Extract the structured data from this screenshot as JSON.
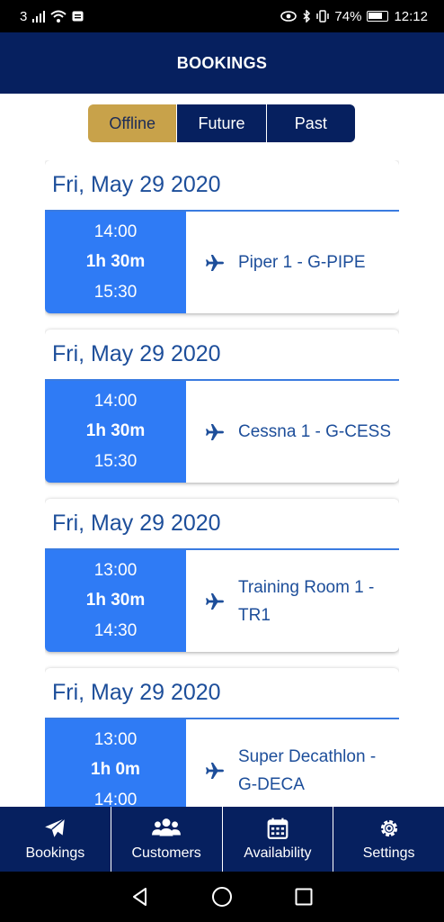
{
  "status_bar": {
    "carrier": "3",
    "battery": "74%",
    "time": "12:12"
  },
  "header": {
    "title": "BOOKINGS"
  },
  "tabs": [
    {
      "label": "Offline",
      "active": true
    },
    {
      "label": "Future",
      "active": false
    },
    {
      "label": "Past",
      "active": false
    }
  ],
  "bookings": [
    {
      "date": "Fri, May 29 2020",
      "start": "14:00",
      "duration": "1h 30m",
      "end": "15:30",
      "resource": "Piper 1 - G-PIPE"
    },
    {
      "date": "Fri, May 29 2020",
      "start": "14:00",
      "duration": "1h 30m",
      "end": "15:30",
      "resource": "Cessna 1 - G-CESS"
    },
    {
      "date": "Fri, May 29 2020",
      "start": "13:00",
      "duration": "1h 30m",
      "end": "14:30",
      "resource": "Training Room 1 - TR1"
    },
    {
      "date": "Fri, May 29 2020",
      "start": "13:00",
      "duration": "1h 0m",
      "end": "14:00",
      "resource": "Super Decathlon - G-DECA"
    }
  ],
  "bottom_nav": [
    {
      "label": "Bookings",
      "icon": "paper-plane-icon"
    },
    {
      "label": "Customers",
      "icon": "users-icon"
    },
    {
      "label": "Availability",
      "icon": "calendar-icon"
    },
    {
      "label": "Settings",
      "icon": "gear-icon"
    }
  ],
  "colors": {
    "navy": "#06205f",
    "gold": "#c8a24a",
    "blue": "#2f7bf5",
    "text_blue": "#1d4e9a"
  }
}
